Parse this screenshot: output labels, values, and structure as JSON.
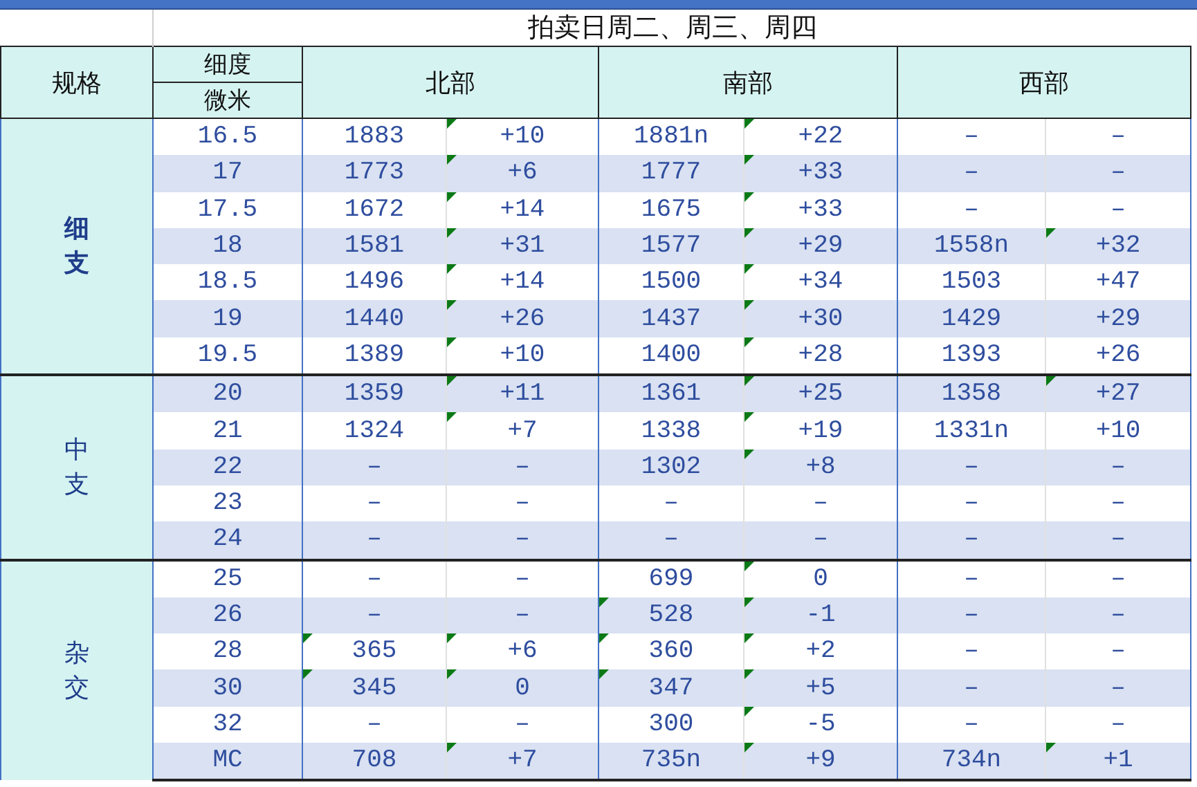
{
  "title": "拍卖日周二、周三、周四",
  "header": {
    "spec": "规格",
    "fineness_top": "细度",
    "fineness_bottom": "微米",
    "regions": [
      "北部",
      "南部",
      "西部"
    ]
  },
  "groups": [
    {
      "name": "细支",
      "bold": true,
      "rows": [
        {
          "micron": "16.5",
          "cells": [
            "1883",
            "+10",
            "1881n",
            "+22",
            "–",
            "–"
          ],
          "marked": [
            false,
            true,
            false,
            true,
            false,
            false
          ]
        },
        {
          "micron": "17",
          "cells": [
            "1773",
            "+6",
            "1777",
            "+33",
            "–",
            "–"
          ],
          "marked": [
            false,
            true,
            false,
            true,
            false,
            false
          ]
        },
        {
          "micron": "17.5",
          "cells": [
            "1672",
            "+14",
            "1675",
            "+33",
            "–",
            "–"
          ],
          "marked": [
            false,
            true,
            false,
            true,
            false,
            false
          ]
        },
        {
          "micron": "18",
          "cells": [
            "1581",
            "+31",
            "1577",
            "+29",
            "1558n",
            "+32"
          ],
          "marked": [
            false,
            true,
            false,
            true,
            false,
            true
          ]
        },
        {
          "micron": "18.5",
          "cells": [
            "1496",
            "+14",
            "1500",
            "+34",
            "1503",
            "+47"
          ],
          "marked": [
            false,
            true,
            false,
            true,
            false,
            false
          ]
        },
        {
          "micron": "19",
          "cells": [
            "1440",
            "+26",
            "1437",
            "+30",
            "1429",
            "+29"
          ],
          "marked": [
            false,
            true,
            false,
            true,
            false,
            false
          ]
        },
        {
          "micron": "19.5",
          "cells": [
            "1389",
            "+10",
            "1400",
            "+28",
            "1393",
            "+26"
          ],
          "marked": [
            false,
            true,
            false,
            true,
            false,
            false
          ]
        }
      ]
    },
    {
      "name": "中支",
      "bold": false,
      "rows": [
        {
          "micron": "20",
          "cells": [
            "1359",
            "+11",
            "1361",
            "+25",
            "1358",
            "+27"
          ],
          "marked": [
            false,
            true,
            false,
            true,
            false,
            true
          ]
        },
        {
          "micron": "21",
          "cells": [
            "1324",
            "+7",
            "1338",
            "+19",
            "1331n",
            "+10"
          ],
          "marked": [
            false,
            true,
            false,
            true,
            false,
            false
          ]
        },
        {
          "micron": "22",
          "cells": [
            "–",
            "–",
            "1302",
            "+8",
            "–",
            "–"
          ],
          "marked": [
            false,
            false,
            false,
            true,
            false,
            false
          ]
        },
        {
          "micron": "23",
          "cells": [
            "–",
            "–",
            "–",
            "–",
            "–",
            "–"
          ],
          "marked": [
            false,
            false,
            false,
            false,
            false,
            false
          ]
        },
        {
          "micron": "24",
          "cells": [
            "–",
            "–",
            "–",
            "–",
            "–",
            "–"
          ],
          "marked": [
            false,
            false,
            false,
            false,
            false,
            false
          ]
        }
      ]
    },
    {
      "name": "杂交",
      "bold": false,
      "rows": [
        {
          "micron": "25",
          "cells": [
            "–",
            "–",
            "699",
            "0",
            "–",
            "–"
          ],
          "marked": [
            false,
            false,
            false,
            true,
            false,
            false
          ]
        },
        {
          "micron": "26",
          "cells": [
            "–",
            "–",
            "528",
            "-1",
            "–",
            "–"
          ],
          "marked": [
            false,
            false,
            true,
            true,
            false,
            false
          ]
        },
        {
          "micron": "28",
          "cells": [
            "365",
            "+6",
            "360",
            "+2",
            "–",
            "–"
          ],
          "marked": [
            true,
            true,
            true,
            true,
            false,
            false
          ]
        },
        {
          "micron": "30",
          "cells": [
            "345",
            "0",
            "347",
            "+5",
            "–",
            "–"
          ],
          "marked": [
            true,
            true,
            true,
            true,
            false,
            false
          ]
        },
        {
          "micron": "32",
          "cells": [
            "–",
            "–",
            "300",
            "-5",
            "–",
            "–"
          ],
          "marked": [
            false,
            false,
            false,
            true,
            false,
            false
          ]
        },
        {
          "micron": "MC",
          "cells": [
            "708",
            "+7",
            "735n",
            "+9",
            "734n",
            "+1"
          ],
          "marked": [
            false,
            true,
            false,
            true,
            false,
            true
          ]
        }
      ]
    }
  ]
}
